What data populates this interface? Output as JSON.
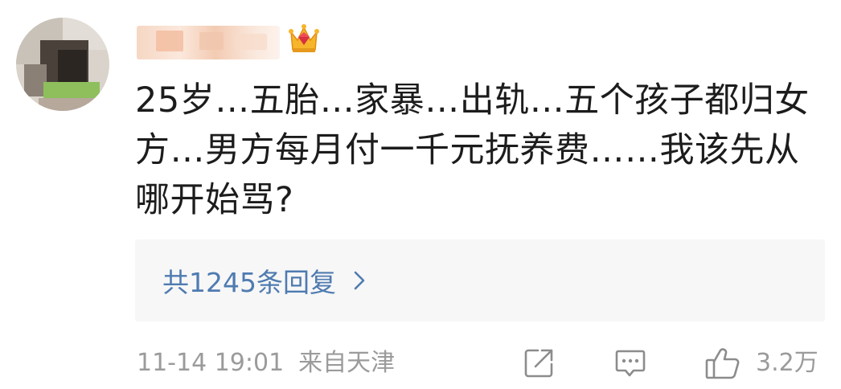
{
  "comment": {
    "avatar_icon": "blurred-avatar",
    "username_icon": "blurred-username",
    "badge_icon": "crown-icon",
    "text": "25岁…五胎…家暴…出轨…五个孩子都归女方…男方每月付一千元抚养费……我该先从哪开始骂?",
    "replies_label": "共1245条回复",
    "timestamp": "11-14 19:01",
    "location": "来自天津",
    "likes": "3.2万",
    "colors": {
      "link": "#4f7bb0",
      "meta": "#9b9b9b",
      "text": "#1c1c1c",
      "reply_bg": "#f7f7f7"
    }
  }
}
